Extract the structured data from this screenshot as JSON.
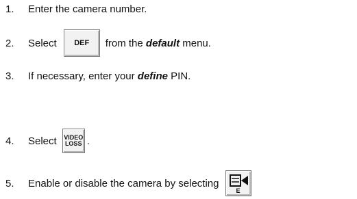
{
  "steps": [
    {
      "num": "1.",
      "text": "Enter the camera number."
    },
    {
      "num": "2.",
      "pre": "Select",
      "button": "DEF",
      "mid": "from the",
      "keyword": "default",
      "post": "menu."
    },
    {
      "num": "3.",
      "pre": "If necessary, enter your",
      "keyword": "define",
      "post": "PIN."
    },
    {
      "num": "4.",
      "pre": "Select",
      "button_line1": "VIDEO",
      "button_line2": "LOSS",
      "post": "."
    },
    {
      "num": "5.",
      "pre": "Enable or disable the camera by selecting",
      "button_letter": "E",
      "button_icon": "camera-icon"
    }
  ]
}
